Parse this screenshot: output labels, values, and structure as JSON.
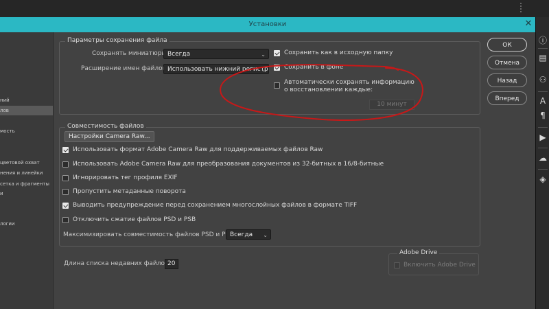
{
  "window": {
    "title": "Установки"
  },
  "sidebar": {
    "items": [
      {
        "label": "ний",
        "selected": false
      },
      {
        "label": "лов",
        "selected": true
      },
      {
        "label": "мость",
        "selected": false
      },
      {
        "label": "цветовой охват",
        "selected": false
      },
      {
        "label": "нения и линейки",
        "selected": false
      },
      {
        "label": "сетка и фрагменты",
        "selected": false
      },
      {
        "label": "и",
        "selected": false
      },
      {
        "label": "логии",
        "selected": false
      }
    ]
  },
  "save_options": {
    "group_title": "Параметры сохранения файла",
    "thumbnails_label": "Сохранять миниатюры:",
    "thumbnails_value": "Всегда",
    "extension_label": "Расширение имен файлов:",
    "extension_value": "Использовать нижний регистр",
    "save_original_folder": {
      "label": "Сохранить как в исходную папку",
      "checked": true
    },
    "save_background": {
      "label": "Сохранить в фоне",
      "checked": true
    },
    "autosave": {
      "label_line1": "Автоматически сохранять информацию",
      "label_line2": "о восстановлении каждые:",
      "checked": false
    },
    "autosave_interval": "10 минут"
  },
  "compat": {
    "group_title": "Совместимость файлов",
    "camera_raw_button": "Настройки Camera Raw...",
    "options": [
      {
        "label": "Использовать формат Adobe Camera Raw для поддерживаемых файлов Raw",
        "checked": true
      },
      {
        "label": "Использовать Adobe Camera Raw для преобразования документов из 32-битных в 16/8-битные",
        "checked": false
      },
      {
        "label": "Игнорировать тег профиля EXIF",
        "checked": false
      },
      {
        "label": "Пропустить метаданные поворота",
        "checked": false
      },
      {
        "label": "Выводить предупреждение перед сохранением многослойных файлов в формате TIFF",
        "checked": true
      },
      {
        "label": "Отключить сжатие файлов PSD и PSB",
        "checked": false
      }
    ],
    "maximize_label": "Максимизировать совместимость файлов PSD и PSB:",
    "maximize_value": "Всегда"
  },
  "recent": {
    "label": "Длина списка недавних файлов:",
    "value": "20"
  },
  "adobe_drive": {
    "group_title": "Adobe Drive",
    "enable_label": "Включить Adobe Drive",
    "checked": false,
    "disabled": true
  },
  "buttons": {
    "ok": "ОК",
    "cancel": "Отмена",
    "back": "Назад",
    "next": "Вперед"
  },
  "right_panel": {
    "icons": [
      "info-icon",
      "properties-icon",
      "person-adjust-icon",
      "type-icon",
      "paragraph-icon",
      "play-icon",
      "creative-cloud-icon",
      "layers-icon"
    ]
  },
  "colors": {
    "titlebar": "#2bb8c4",
    "dialog_bg": "#424242",
    "annotation": "#c81818"
  }
}
